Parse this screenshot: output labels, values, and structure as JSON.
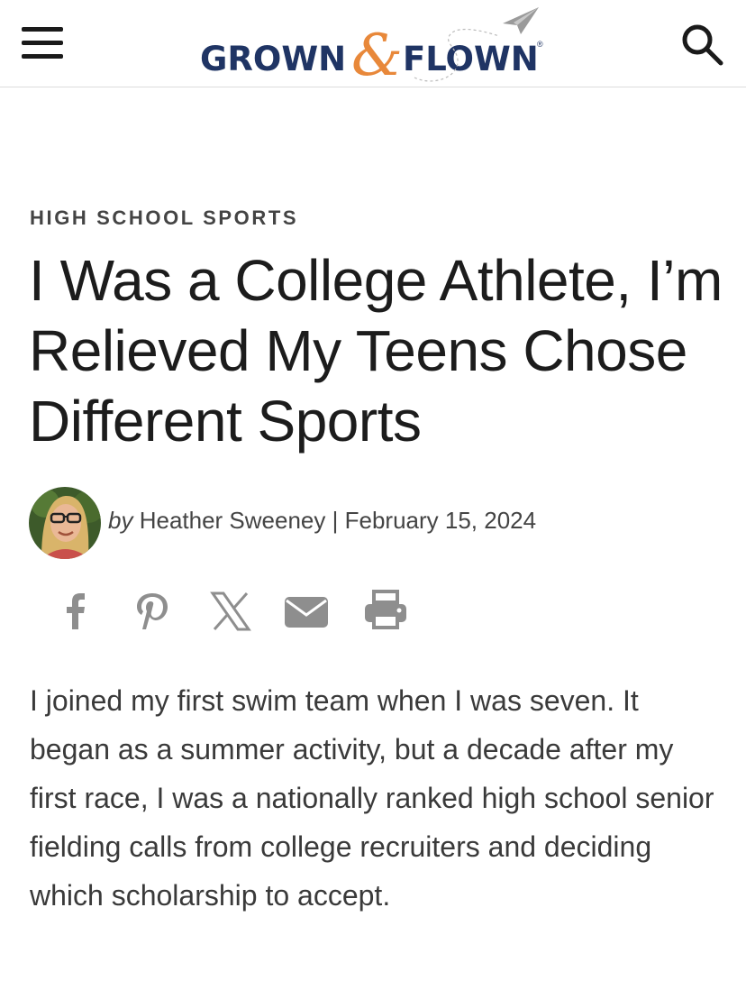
{
  "header": {
    "menu_icon": "hamburger-menu-icon",
    "logo": {
      "word_left": "GROWN",
      "ampersand": "&",
      "word_right": "FLOWN",
      "registered": "®",
      "plane_icon": "paper-plane-icon"
    },
    "search_icon": "search-icon",
    "colors": {
      "logo_navy": "#1f3464",
      "logo_orange": "#e8883a"
    }
  },
  "article": {
    "category": "HIGH SCHOOL SPORTS",
    "title": "I Was a College Athlete, I’m Relieved My Teens Chose Different Sports",
    "byline": {
      "prefix": "by",
      "author": "Heather Sweeney",
      "separator": "|",
      "date": "February 15, 2024"
    },
    "share_icons": [
      "facebook-icon",
      "pinterest-icon",
      "x-icon",
      "email-icon",
      "print-icon"
    ],
    "body": "I joined my first swim team when I was seven. It began as a summer activity, but a decade after my first race, I was a nationally ranked high school senior fielding calls from college recruiters and deciding which scholarship to accept."
  }
}
